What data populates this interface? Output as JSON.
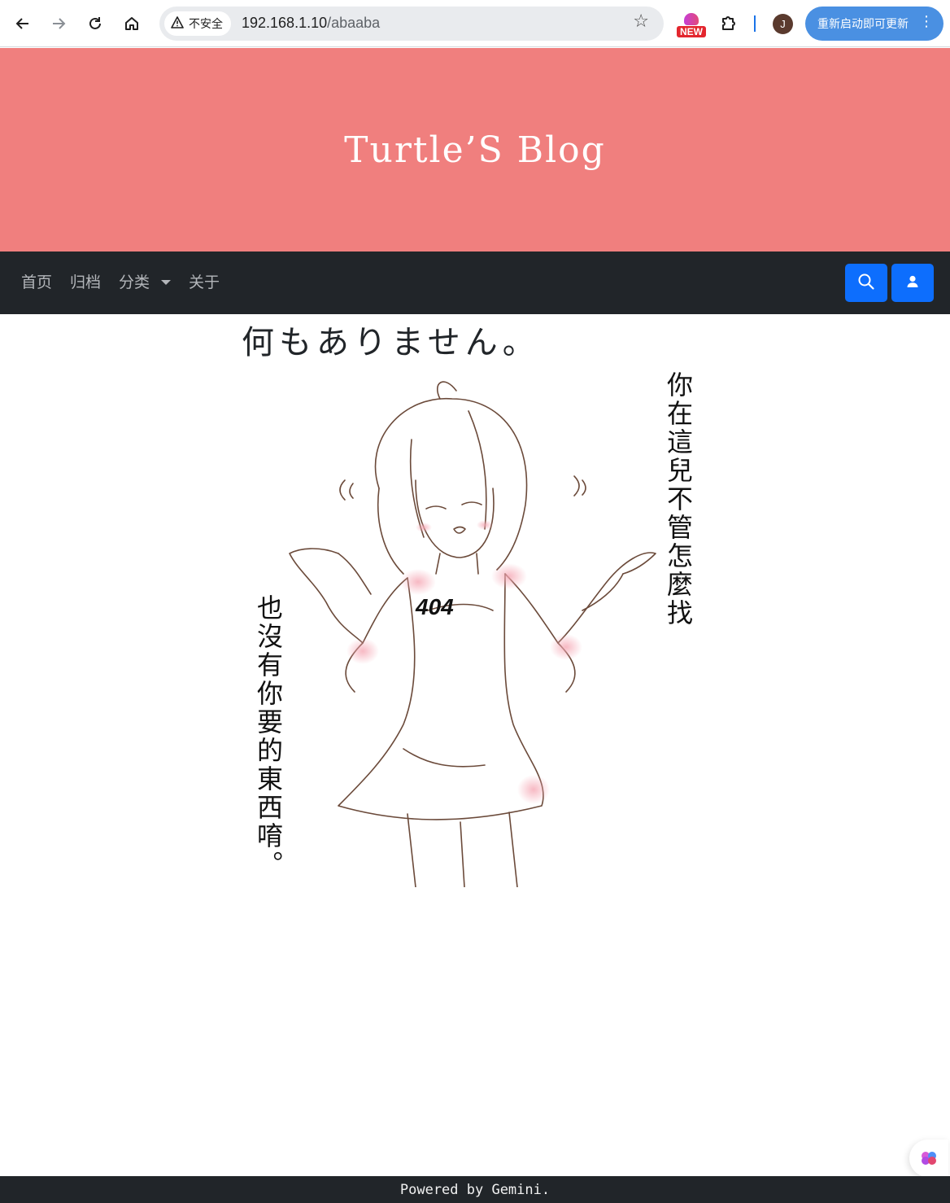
{
  "browser": {
    "security_label": "不安全",
    "url_host": "192.168.1.10",
    "url_path": "/abaaba",
    "extension_badge": "NEW",
    "profile_initial": "J",
    "update_button_label": "重新启动即可更新"
  },
  "site": {
    "title": "Turtle’S Blog"
  },
  "nav": {
    "items": [
      {
        "label": "首页"
      },
      {
        "label": "归档"
      },
      {
        "label": "分类"
      },
      {
        "label": "关于"
      }
    ]
  },
  "main": {
    "heading": "何もありません。",
    "illustration": {
      "badge_text": "404",
      "right_caption": "你在這兒不管怎麼找",
      "left_caption": "也沒有你要的東西唷。"
    }
  },
  "footer": {
    "text": "Powered by Gemini."
  },
  "colors": {
    "banner": "#f07f7e",
    "navbar": "#212529",
    "primary_button": "#0d6efd",
    "chrome_update_button": "#4a90e2"
  }
}
